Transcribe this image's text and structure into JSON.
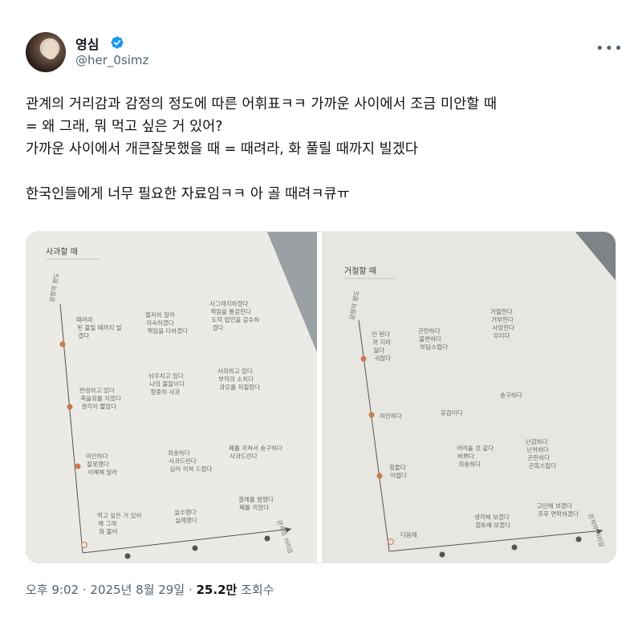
{
  "user": {
    "display_name": "영심",
    "handle": "@her_0simz"
  },
  "tweet": {
    "text": "관계의 거리감과 감정의 정도에 따른 어휘표ㅋㅋ 가까운 사이에서 조금 미안할 때\n= 왜 그래, 뭐 먹고 싶은 거 있어?\n가까운 사이에서 개큰잘못했을 때 = 때려라, 화 풀릴 때까지 빌겠다\n\n한국인들에게 너무 필요한 자료임ㅋㅋ 아 골 때려ㅋ큐ㅠ"
  },
  "media": {
    "left_page": {
      "title": "사과할 때",
      "axis_y": "감정의 정도",
      "axis_x": "관계의 거리감",
      "cells": [
        [
          "때려라",
          "된 풀릴 때까지 빌",
          "겠다"
        ],
        [
          "철저히 알라",
          "자숙하겠다",
          "책임을 다하겠다"
        ],
        [
          "사그래지하겠다",
          "책임을 통감한다",
          "도덕 법인을 감수하",
          "겠다"
        ],
        [
          "반성하고 있다",
          "죽을죄를 지었다",
          "생각이 짧았다"
        ],
        [
          "뉘우치고 있다",
          "나의 불찰이다",
          "정중히 사과"
        ],
        [
          "사죄하고 있다",
          "부덕의 소치다",
          "과오를 저질렀다"
        ],
        [
          "미안하다",
          "잘못했다",
          "이해해 달라"
        ],
        [
          "죄송하다",
          "사과드린다",
          "심려 끼쳐 드렸다"
        ],
        [
          "폐를 끼쳐서 송구하다",
          "사과드린다"
        ],
        [
          "먹고 싶은 거 있어",
          "왜 그래",
          "화 풀어"
        ],
        [
          "실수했다",
          "실례했다"
        ],
        [
          "결례를 범했다",
          "폐를 끼쳤다"
        ]
      ]
    },
    "right_page": {
      "title": "거절할 때",
      "axis_y": "감정의 정도",
      "axis_x": "관계의 거리감",
      "cells": [
        [
          "안 된다",
          "꺼 지라",
          "싫다",
          "귀찮다"
        ],
        [
          "곤란하다",
          "불편하다",
          "부담스럽다"
        ],
        [
          "거절한다",
          "거부한다",
          "사양한다",
          "무리다"
        ],
        [
          "미안하다"
        ],
        [
          "유감이다"
        ],
        [
          "송구하다"
        ],
        [
          "힘들다",
          "어렵다"
        ],
        [
          "어려울 것 같다",
          "바쁘다",
          "죄송하다"
        ],
        [
          "난감하다",
          "난처하다",
          "곤란하다",
          "곤혹스럽다"
        ],
        [
          "다음에"
        ],
        [
          "생각해 보겠다",
          "검토해 보겠다"
        ],
        [
          "고민해 보겠다",
          "추후 연락하겠다"
        ]
      ]
    }
  },
  "meta": {
    "time": "오후 9:02",
    "separator": "·",
    "date": "2025년 8월 29일",
    "views": "25.2만",
    "views_label": "조회수"
  },
  "colors": {
    "verified": "#1d9bf0",
    "secondary_text": "#536471",
    "axis_marker": "#c87b4f"
  }
}
